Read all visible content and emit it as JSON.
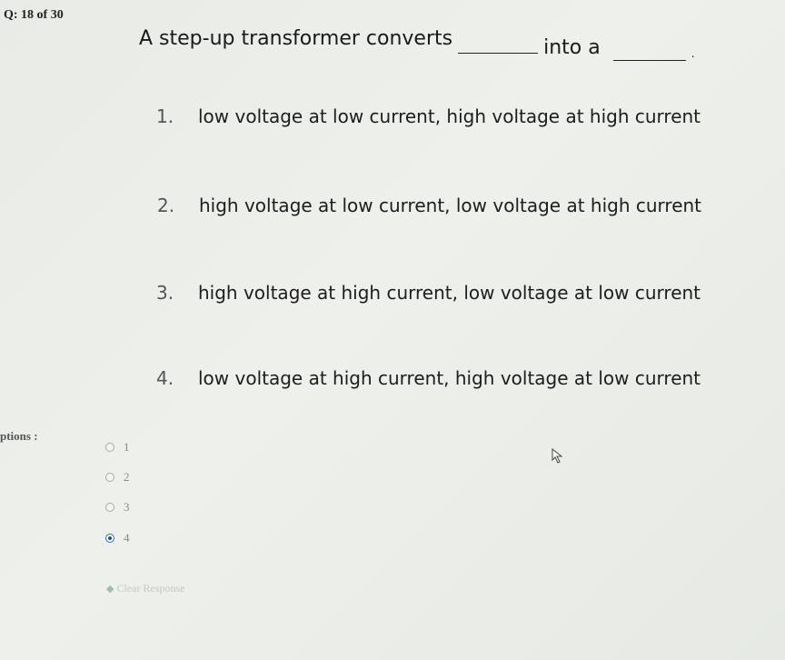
{
  "question_number": "Q: 18 of 30",
  "question": {
    "part1": "A step-up transformer converts",
    "part2": "into a",
    "part3": "."
  },
  "options": [
    {
      "num": "1.",
      "text": "low voltage at low current, high voltage at high current"
    },
    {
      "num": "2.",
      "text": "high voltage at low current, low voltage at high current"
    },
    {
      "num": "3.",
      "text": "high voltage at high current, low voltage at low current"
    },
    {
      "num": "4.",
      "text": "low voltage at high current, high voltage at low current"
    }
  ],
  "answer_section": {
    "label": "ptions :",
    "choices": [
      {
        "value": "1",
        "selected": false
      },
      {
        "value": "2",
        "selected": false
      },
      {
        "value": "3",
        "selected": false
      },
      {
        "value": "4",
        "selected": true
      }
    ],
    "clear_label": "Clear Response",
    "clear_icon": "eraser-icon"
  },
  "colors": {
    "selected_radio": "#1c4f9a",
    "text": "#1a1a1a"
  }
}
